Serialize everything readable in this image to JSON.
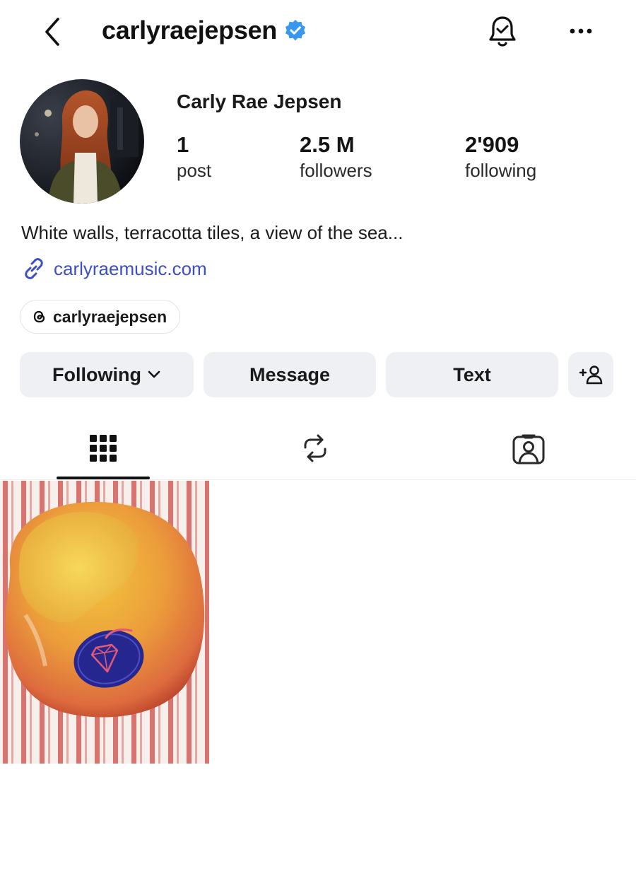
{
  "header": {
    "username": "carlyraejepsen",
    "verified": true,
    "icons": [
      "back-chevron-icon",
      "verified-badge-icon",
      "bell-icon",
      "more-icon"
    ],
    "accent": "#3897f0"
  },
  "profile": {
    "full_name": "Carly Rae Jepsen",
    "stats": [
      {
        "value": "1",
        "label": "post"
      },
      {
        "value": "2.5 M",
        "label": "followers"
      },
      {
        "value": "2'909",
        "label": "following"
      }
    ],
    "bio": "White walls, terracotta tiles, a view of the sea...",
    "link": "carlyraemusic.com",
    "link_color": "#3d4fc4",
    "threads_handle": "carlyraejepsen"
  },
  "actions": {
    "following_label": "Following",
    "message_label": "Message",
    "text_label": "Text",
    "add_user_icon": "add-person-icon"
  },
  "tabs": {
    "items": [
      "grid-icon",
      "reposts-icon",
      "tagged-icon"
    ],
    "selected": 0
  },
  "grid": {
    "posts": [
      {
        "subject": "peach-with-sticker"
      }
    ]
  }
}
